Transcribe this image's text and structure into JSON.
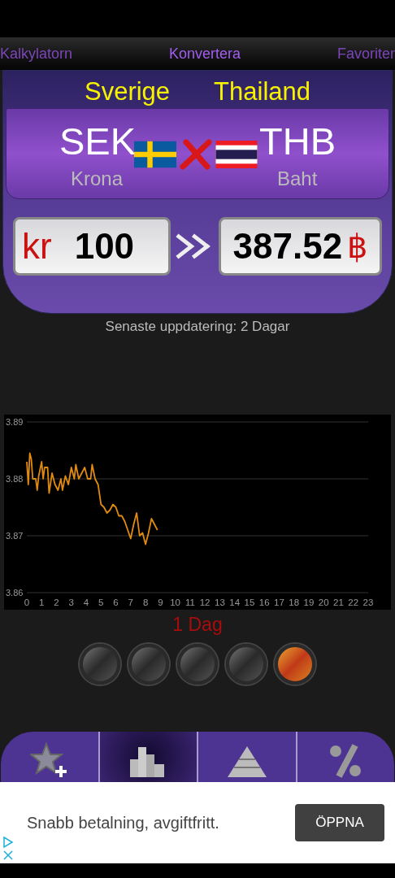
{
  "tabs": [
    {
      "label": "Kalkylatorn",
      "selected": false
    },
    {
      "label": "Konvertera",
      "selected": true
    },
    {
      "label": "Favoriter",
      "selected": false
    }
  ],
  "converter": {
    "from_country": "Sverige",
    "to_country": "Thailand",
    "from_code": "SEK",
    "to_code": "THB",
    "from_name": "Krona",
    "to_name": "Baht",
    "from_symbol": "kr",
    "from_amount": "100",
    "to_amount": "387.52",
    "to_symbol": "฿"
  },
  "last_update": "Senaste uppdatering: 2 Dagar",
  "chart": {
    "chart_data": {
      "type": "line",
      "x": [
        0,
        0.1,
        0.2,
        0.3,
        0.4,
        0.6,
        0.7,
        0.8,
        1.0,
        1.1,
        1.2,
        1.4,
        1.5,
        1.7,
        1.9,
        2.1,
        2.3,
        2.4,
        2.6,
        2.8,
        3.0,
        3.2,
        3.3,
        3.5,
        3.7,
        3.9,
        4.1,
        4.3,
        4.4,
        4.6,
        4.8,
        5.0,
        5.2,
        5.4,
        5.6,
        5.8,
        6.0,
        6.2,
        6.4,
        6.6,
        7.0,
        7.2,
        7.4,
        7.6,
        7.8,
        8.0,
        8.2,
        8.4,
        8.6,
        8.8
      ],
      "series": [
        {
          "color": "#e08a10",
          "values": [
            3.883,
            3.879,
            3.8845,
            3.8835,
            3.88,
            3.88,
            3.878,
            3.8805,
            3.883,
            3.88,
            3.882,
            3.882,
            3.8775,
            3.881,
            3.879,
            3.878,
            3.88,
            3.878,
            3.8805,
            3.879,
            3.882,
            3.88,
            3.8825,
            3.88,
            3.881,
            3.882,
            3.88,
            3.88,
            3.8825,
            3.88,
            3.879,
            3.8755,
            3.875,
            3.874,
            3.8745,
            3.8755,
            3.875,
            3.8735,
            3.8735,
            3.8725,
            3.8695,
            3.872,
            3.874,
            3.87,
            3.8705,
            3.8685,
            3.8705,
            3.873,
            3.872,
            3.871
          ]
        }
      ],
      "xlim": [
        0,
        23
      ],
      "ylim": [
        3.86,
        3.89
      ],
      "xticks": [
        0,
        1,
        2,
        3,
        4,
        5,
        6,
        7,
        8,
        9,
        10,
        11,
        12,
        13,
        14,
        15,
        16,
        17,
        18,
        19,
        20,
        21,
        22,
        23
      ],
      "yticks": [
        3.86,
        3.87,
        3.88,
        3.89
      ]
    }
  },
  "period_label": "1 Dag",
  "periods": [
    {
      "selected": false
    },
    {
      "selected": false
    },
    {
      "selected": false
    },
    {
      "selected": false
    },
    {
      "selected": true
    }
  ],
  "nav": [
    {
      "kind": "favorite",
      "selected": false
    },
    {
      "kind": "chart",
      "selected": true
    },
    {
      "kind": "pyramid",
      "selected": false
    },
    {
      "kind": "percent",
      "selected": false
    }
  ],
  "ad": {
    "text": "Snabb betalning, avgiftfritt.",
    "button": "ÖPPNA"
  }
}
